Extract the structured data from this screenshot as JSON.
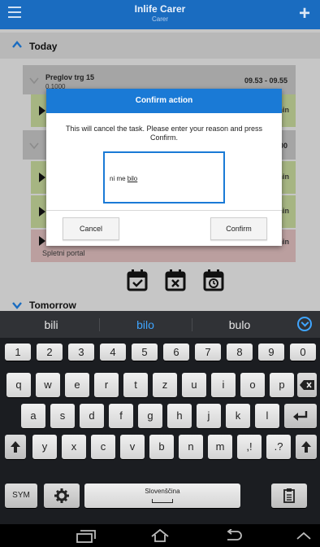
{
  "app": {
    "title": "Inlife Carer",
    "subtitle": "Carer"
  },
  "sections": {
    "today": "Today",
    "tomorrow": "Tomorrow"
  },
  "tasks": [
    {
      "name": "Preglov trg 15",
      "code": "0.1000",
      "time": "09.53 - 09.55"
    },
    {
      "time_partial": "1.00"
    }
  ],
  "rows": [
    {
      "duration_partial": "min",
      "color": "green"
    },
    {
      "duration_partial": "min",
      "color": "green"
    },
    {
      "duration_partial": "min",
      "color": "green"
    },
    {
      "duration_partial": "min",
      "color": "red",
      "subtitle": "Spletni portal"
    }
  ],
  "dialog": {
    "title": "Confirm action",
    "message": "This will cancel the task. Please enter your reason and press Confirm.",
    "input_value_prefix": "ni me ",
    "input_value_underlined": "bilo",
    "cancel_label": "Cancel",
    "confirm_label": "Confirm"
  },
  "keyboard": {
    "suggestions": [
      "bili",
      "bilo",
      "bulo"
    ],
    "number_row": [
      "1",
      "2",
      "3",
      "4",
      "5",
      "6",
      "7",
      "8",
      "9",
      "0"
    ],
    "row1": [
      "q",
      "w",
      "e",
      "r",
      "t",
      "z",
      "u",
      "i",
      "o",
      "p"
    ],
    "row2": [
      "a",
      "s",
      "d",
      "f",
      "g",
      "h",
      "j",
      "k",
      "l"
    ],
    "row3": [
      "y",
      "x",
      "c",
      "v",
      "b",
      "n",
      "m"
    ],
    "punct1": ",!",
    "punct2": ".?",
    "sym_label": "SYM",
    "space_label": "Slovenščina"
  },
  "colors": {
    "accent": "#1a7ad6",
    "appbar": "#1a6cc0",
    "suggestion_selected": "#3fa5ff"
  }
}
